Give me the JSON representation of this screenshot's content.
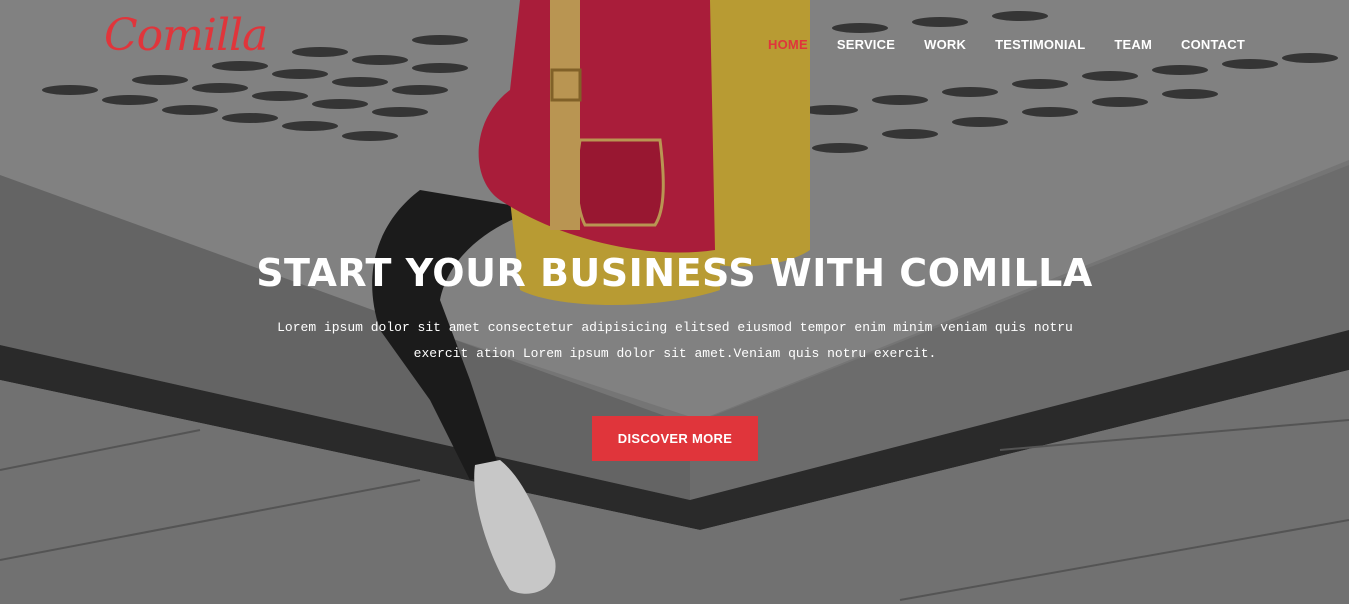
{
  "brand": {
    "logo_text": "Comilla",
    "accent_color": "#e0353b"
  },
  "nav": {
    "items": [
      {
        "label": "HOME",
        "active": true
      },
      {
        "label": "SERVICE",
        "active": false
      },
      {
        "label": "WORK",
        "active": false
      },
      {
        "label": "TESTIMONIAL",
        "active": false
      },
      {
        "label": "TEAM",
        "active": false
      },
      {
        "label": "CONTACT",
        "active": false
      }
    ]
  },
  "hero": {
    "headline": "START YOUR BUSINESS WITH COMILLA",
    "subtext": "Lorem ipsum dolor sit amet consectetur adipisicing elitsed eiusmod tempor enim minim veniam quis notru exercit ation Lorem ipsum dolor sit amet.Veniam quis notru exercit.",
    "cta_label": "DISCOVER MORE"
  }
}
